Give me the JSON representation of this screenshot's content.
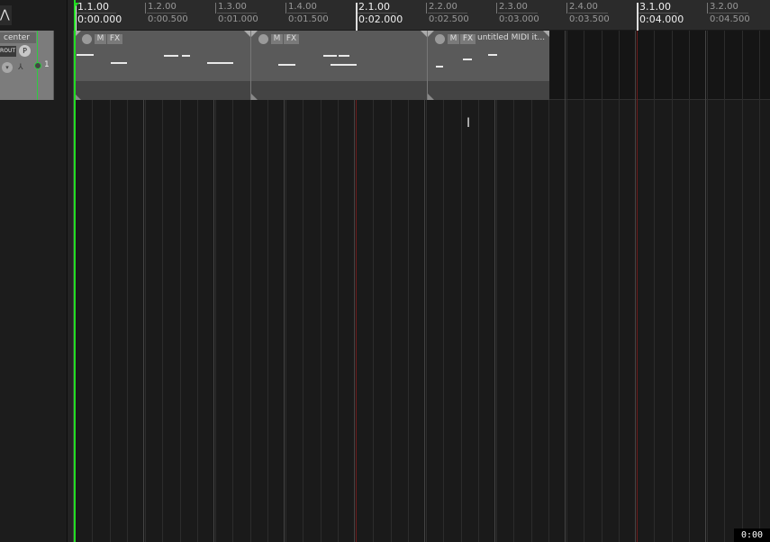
{
  "tcp": {
    "track_name": "center",
    "route_label": "ROUT",
    "phase_label": "P",
    "track_number": "1",
    "env_icon": "envelope-icon",
    "arm_icon": "record-arm-icon"
  },
  "ruler": {
    "labels": [
      {
        "top": "1.1.00",
        "bottom": "0:00.000",
        "major": true
      },
      {
        "top": "1.2.00",
        "bottom": "0:00.500",
        "major": false
      },
      {
        "top": "1.3.00",
        "bottom": "0:01.000",
        "major": false
      },
      {
        "top": "1.4.00",
        "bottom": "0:01.500",
        "major": false
      },
      {
        "top": "2.1.00",
        "bottom": "0:02.000",
        "major": true
      },
      {
        "top": "2.2.00",
        "bottom": "0:02.500",
        "major": false
      },
      {
        "top": "2.3.00",
        "bottom": "0:03.000",
        "major": false
      },
      {
        "top": "2.4.00",
        "bottom": "0:03.500",
        "major": false
      },
      {
        "top": "3.1.00",
        "bottom": "0:04.000",
        "major": true
      },
      {
        "top": "3.2.00",
        "bottom": "0:04.500",
        "major": false
      }
    ]
  },
  "items": [
    {
      "mute": "M",
      "fx": "FX",
      "title": ""
    },
    {
      "mute": "M",
      "fx": "FX",
      "title": ""
    },
    {
      "mute": "M",
      "fx": "FX",
      "title": "untitled MIDI it..."
    }
  ],
  "time_display": "0:00"
}
